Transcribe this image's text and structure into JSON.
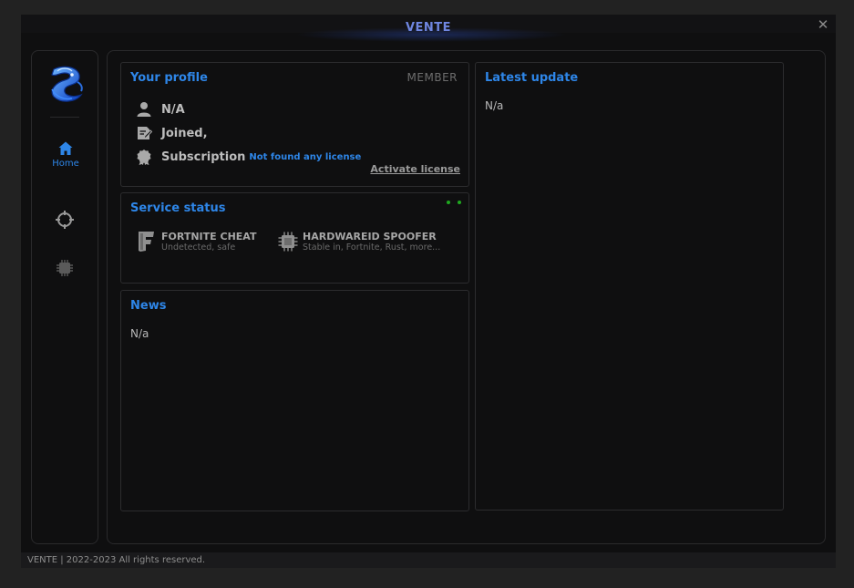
{
  "window": {
    "title": "VENTE",
    "footer": "VENTE | 2022-2023 All rights reserved."
  },
  "colors": {
    "accent": "#2e86e8",
    "title": "#6f86e0",
    "status_online": "#1fa81f",
    "background": "#0f0f10"
  },
  "sidebar": {
    "logo_icon": "dragon-logo-icon",
    "items": [
      {
        "label": "Home",
        "icon": "home-icon",
        "active": true
      },
      {
        "label": "",
        "icon": "crosshair-icon",
        "active": false
      },
      {
        "label": "",
        "icon": "chip-icon",
        "active": false
      }
    ]
  },
  "profile": {
    "title": "Your profile",
    "role": "MEMBER",
    "username": "N/A",
    "joined": "Joined,",
    "subscription_label": "Subscription",
    "subscription_value": "Not found any license",
    "activate_link": "Activate license"
  },
  "service_status": {
    "title": "Service status",
    "services": [
      {
        "name": "FORTNITE CHEAT",
        "status": "Undetected, safe",
        "icon": "fortnite-icon"
      },
      {
        "name": "HARDWAREID SPOOFER",
        "status": "Stable in, Fortnite, Rust, more...",
        "icon": "chip-icon"
      }
    ]
  },
  "news": {
    "title": "News",
    "body": "N/a"
  },
  "latest_update": {
    "title": "Latest update",
    "body": "N/a"
  }
}
